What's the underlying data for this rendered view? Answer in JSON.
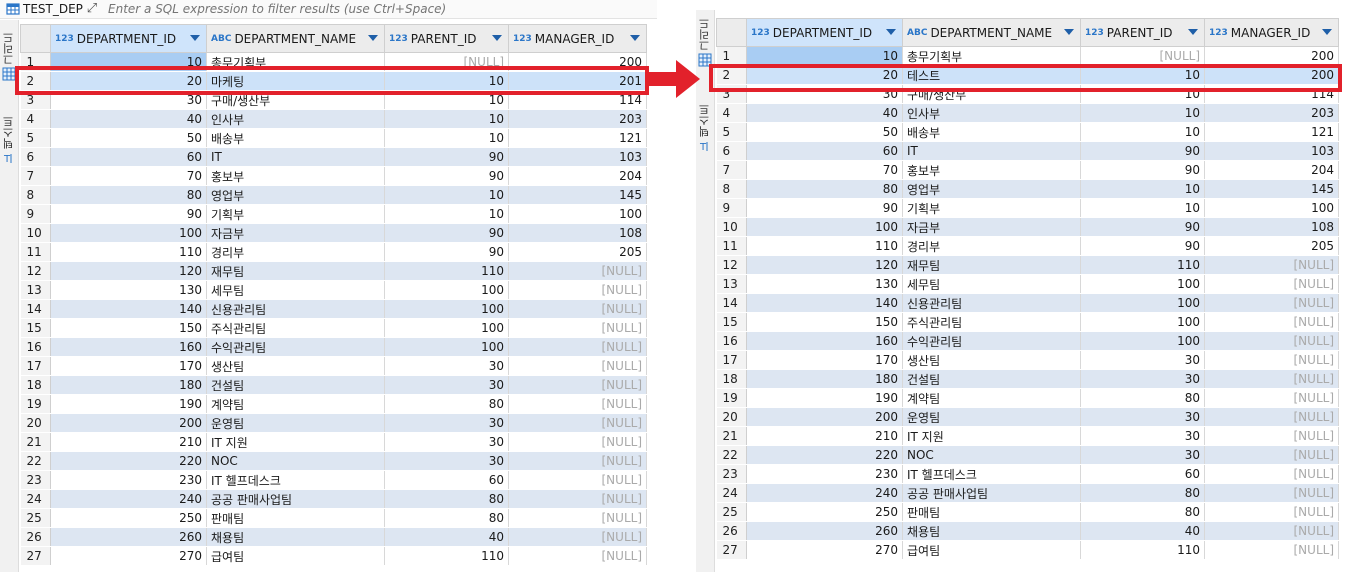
{
  "left": {
    "tab_title": "TEST_DEP",
    "filter_placeholder": "Enter a SQL expression to filter results (use Ctrl+Space)",
    "rail": {
      "grid_label": "그리드",
      "text_label": "텍스트"
    },
    "columns": [
      {
        "type": "123",
        "name": "DEPARTMENT_ID"
      },
      {
        "type": "ABC",
        "name": "DEPARTMENT_NAME"
      },
      {
        "type": "123",
        "name": "PARENT_ID"
      },
      {
        "type": "123",
        "name": "MANAGER_ID"
      }
    ],
    "rows": [
      [
        "1",
        "10",
        "총무기획부",
        "[NULL]",
        "200"
      ],
      [
        "2",
        "20",
        "마케팅",
        "10",
        "201"
      ],
      [
        "3",
        "30",
        "구매/생산부",
        "10",
        "114"
      ],
      [
        "4",
        "40",
        "인사부",
        "10",
        "203"
      ],
      [
        "5",
        "50",
        "배송부",
        "10",
        "121"
      ],
      [
        "6",
        "60",
        "IT",
        "90",
        "103"
      ],
      [
        "7",
        "70",
        "홍보부",
        "90",
        "204"
      ],
      [
        "8",
        "80",
        "영업부",
        "10",
        "145"
      ],
      [
        "9",
        "90",
        "기획부",
        "10",
        "100"
      ],
      [
        "10",
        "100",
        "자금부",
        "90",
        "108"
      ],
      [
        "11",
        "110",
        "경리부",
        "90",
        "205"
      ],
      [
        "12",
        "120",
        "재무팀",
        "110",
        "[NULL]"
      ],
      [
        "13",
        "130",
        "세무팀",
        "100",
        "[NULL]"
      ],
      [
        "14",
        "140",
        "신용관리팀",
        "100",
        "[NULL]"
      ],
      [
        "15",
        "150",
        "주식관리팀",
        "100",
        "[NULL]"
      ],
      [
        "16",
        "160",
        "수익관리팀",
        "100",
        "[NULL]"
      ],
      [
        "17",
        "170",
        "생산팀",
        "30",
        "[NULL]"
      ],
      [
        "18",
        "180",
        "건설팀",
        "30",
        "[NULL]"
      ],
      [
        "19",
        "190",
        "계약팀",
        "80",
        "[NULL]"
      ],
      [
        "20",
        "200",
        "운영팀",
        "30",
        "[NULL]"
      ],
      [
        "21",
        "210",
        "IT 지원",
        "30",
        "[NULL]"
      ],
      [
        "22",
        "220",
        "NOC",
        "30",
        "[NULL]"
      ],
      [
        "23",
        "230",
        "IT 헬프데스크",
        "60",
        "[NULL]"
      ],
      [
        "24",
        "240",
        "공공 판매사업팀",
        "80",
        "[NULL]"
      ],
      [
        "25",
        "250",
        "판매팀",
        "80",
        "[NULL]"
      ],
      [
        "26",
        "260",
        "채용팀",
        "40",
        "[NULL]"
      ],
      [
        "27",
        "270",
        "급여팀",
        "110",
        "[NULL]"
      ]
    ]
  },
  "right": {
    "rail": {
      "grid_label": "그리드",
      "text_label": "텍스트"
    },
    "columns": [
      {
        "type": "123",
        "name": "DEPARTMENT_ID"
      },
      {
        "type": "ABC",
        "name": "DEPARTMENT_NAME"
      },
      {
        "type": "123",
        "name": "PARENT_ID"
      },
      {
        "type": "123",
        "name": "MANAGER_ID"
      }
    ],
    "rows": [
      [
        "1",
        "10",
        "총무기획부",
        "[NULL]",
        "200"
      ],
      [
        "2",
        "20",
        "테스트",
        "10",
        "200"
      ],
      [
        "3",
        "30",
        "구매/생산부",
        "10",
        "114"
      ],
      [
        "4",
        "40",
        "인사부",
        "10",
        "203"
      ],
      [
        "5",
        "50",
        "배송부",
        "10",
        "121"
      ],
      [
        "6",
        "60",
        "IT",
        "90",
        "103"
      ],
      [
        "7",
        "70",
        "홍보부",
        "90",
        "204"
      ],
      [
        "8",
        "80",
        "영업부",
        "10",
        "145"
      ],
      [
        "9",
        "90",
        "기획부",
        "10",
        "100"
      ],
      [
        "10",
        "100",
        "자금부",
        "90",
        "108"
      ],
      [
        "11",
        "110",
        "경리부",
        "90",
        "205"
      ],
      [
        "12",
        "120",
        "재무팀",
        "110",
        "[NULL]"
      ],
      [
        "13",
        "130",
        "세무팀",
        "100",
        "[NULL]"
      ],
      [
        "14",
        "140",
        "신용관리팀",
        "100",
        "[NULL]"
      ],
      [
        "15",
        "150",
        "주식관리팀",
        "100",
        "[NULL]"
      ],
      [
        "16",
        "160",
        "수익관리팀",
        "100",
        "[NULL]"
      ],
      [
        "17",
        "170",
        "생산팀",
        "30",
        "[NULL]"
      ],
      [
        "18",
        "180",
        "건설팀",
        "30",
        "[NULL]"
      ],
      [
        "19",
        "190",
        "계약팀",
        "80",
        "[NULL]"
      ],
      [
        "20",
        "200",
        "운영팀",
        "30",
        "[NULL]"
      ],
      [
        "21",
        "210",
        "IT 지원",
        "30",
        "[NULL]"
      ],
      [
        "22",
        "220",
        "NOC",
        "30",
        "[NULL]"
      ],
      [
        "23",
        "230",
        "IT 헬프데스크",
        "60",
        "[NULL]"
      ],
      [
        "24",
        "240",
        "공공 판매사업팀",
        "80",
        "[NULL]"
      ],
      [
        "25",
        "250",
        "판매팀",
        "80",
        "[NULL]"
      ],
      [
        "26",
        "260",
        "채용팀",
        "40",
        "[NULL]"
      ],
      [
        "27",
        "270",
        "급여팀",
        "110",
        "[NULL]"
      ]
    ]
  },
  "colors": {
    "highlight": "#e2212b",
    "stripe": "#dde6f2",
    "accent": "#2b76c8"
  },
  "icons": {
    "table": "table-icon",
    "filter": "expand-filter-icon",
    "grid": "grid-icon",
    "text": "text-icon",
    "sort": "sort-arrow-icon"
  }
}
